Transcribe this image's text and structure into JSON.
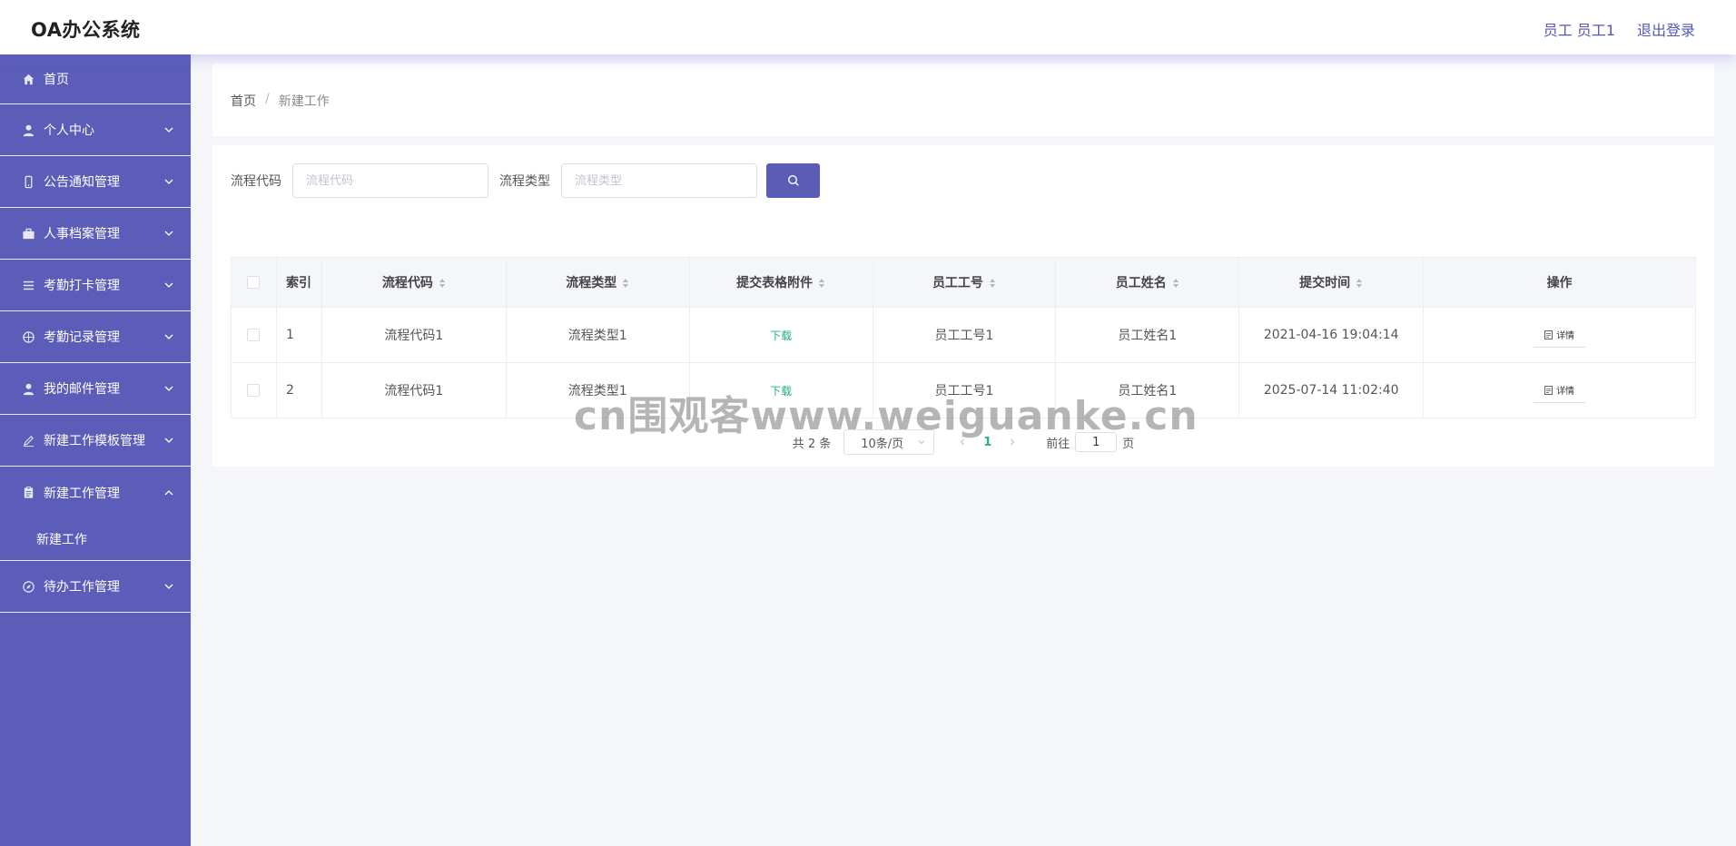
{
  "header": {
    "app_title": "OA办公系统",
    "user_label": "员工 员工1",
    "logout_label": "退出登录"
  },
  "sidebar": {
    "items": [
      {
        "label": "首页",
        "icon": "home-icon"
      },
      {
        "label": "个人中心",
        "icon": "user-icon"
      },
      {
        "label": "公告通知管理",
        "icon": "mobile-icon"
      },
      {
        "label": "人事档案管理",
        "icon": "briefcase-icon"
      },
      {
        "label": "考勤打卡管理",
        "icon": "list-icon"
      },
      {
        "label": "考勤记录管理",
        "icon": "basketball-icon"
      },
      {
        "label": "我的邮件管理",
        "icon": "user-solid-icon"
      },
      {
        "label": "新建工作模板管理",
        "icon": "edit-outline-icon"
      },
      {
        "label": "新建工作管理",
        "icon": "clipboard-icon"
      },
      {
        "label": "待办工作管理",
        "icon": "compass-icon"
      }
    ],
    "open_submenu": {
      "label": "新建工作"
    }
  },
  "breadcrumb": {
    "home": "首页",
    "separator": "/",
    "current": "新建工作"
  },
  "search": {
    "code_label": "流程代码",
    "code_placeholder": "流程代码",
    "type_label": "流程类型",
    "type_placeholder": "流程类型",
    "button_icon": "search-icon"
  },
  "table": {
    "columns": [
      "索引",
      "流程代码",
      "流程类型",
      "提交表格附件",
      "员工工号",
      "员工姓名",
      "提交时间",
      "操作"
    ],
    "rows": [
      {
        "index": "1",
        "code": "流程代码1",
        "type": "流程类型1",
        "attachment": "下载",
        "emp_no": "员工工号1",
        "emp_name": "员工姓名1",
        "time": "2021-04-16 19:04:14",
        "action": "详情"
      },
      {
        "index": "2",
        "code": "流程代码1",
        "type": "流程类型1",
        "attachment": "下载",
        "emp_no": "员工工号1",
        "emp_name": "员工姓名1",
        "time": "2025-07-14 11:02:40",
        "action": "详情"
      }
    ]
  },
  "pagination": {
    "total": "共 2 条",
    "page_size": "10条/页",
    "current_page": "1",
    "goto_prefix": "前往",
    "goto_value": "1",
    "goto_suffix": "页"
  },
  "watermark": "cn围观客www.weiguanke.cn",
  "colors": {
    "sidebar_bg": "#5b5db8",
    "accent": "#5a5cb6",
    "link_green": "#20b08a"
  }
}
